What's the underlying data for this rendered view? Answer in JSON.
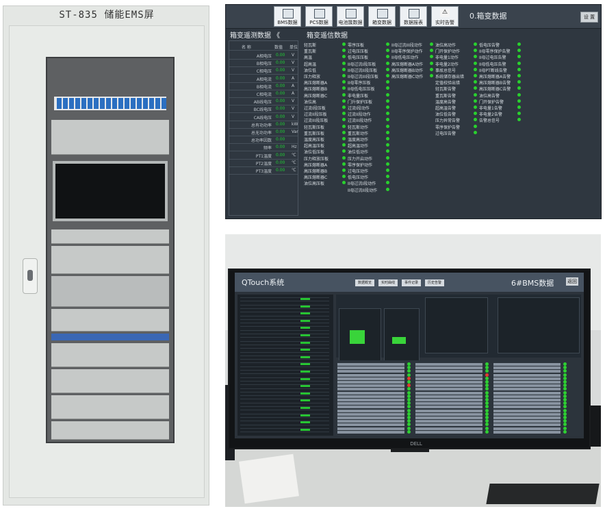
{
  "cabinet": {
    "title": "ST-835 储能EMS屏"
  },
  "screen1": {
    "toolbar": [
      {
        "label": "BMS数据",
        "icon": "battery-icon"
      },
      {
        "label": "PCS数据",
        "icon": "monitor-icon"
      },
      {
        "label": "电池簇数据",
        "icon": "battery-cluster-icon"
      },
      {
        "label": "箱变数据",
        "icon": "transformer-icon"
      },
      {
        "label": "数据报表",
        "icon": "report-icon"
      },
      {
        "label": "实时告警",
        "icon": "warning-icon"
      }
    ],
    "title": "0.箱变数据",
    "settings_label": "设 置",
    "left_title": "箱变遥测数据 《",
    "right_title": "箱变遥信数据",
    "measure_headers": {
      "name": "名 称",
      "value": "数值",
      "unit": "单位"
    },
    "measurements": [
      {
        "name": "A相电压",
        "value": "0.00",
        "unit": "V"
      },
      {
        "name": "B相电压",
        "value": "0.00",
        "unit": "V"
      },
      {
        "name": "C相电压",
        "value": "0.00",
        "unit": "V"
      },
      {
        "name": "A相电流",
        "value": "0.00",
        "unit": "A"
      },
      {
        "name": "B相电流",
        "value": "0.00",
        "unit": "A"
      },
      {
        "name": "C相电流",
        "value": "0.00",
        "unit": "A"
      },
      {
        "name": "AB线电压",
        "value": "0.00",
        "unit": "V"
      },
      {
        "name": "BC线电压",
        "value": "0.00",
        "unit": "V"
      },
      {
        "name": "CA线电压",
        "value": "0.00",
        "unit": "V"
      },
      {
        "name": "总有功功率",
        "value": "0.00",
        "unit": "kW"
      },
      {
        "name": "总无功功率",
        "value": "0.00",
        "unit": "Var"
      },
      {
        "name": "总功率因数",
        "value": "0.00",
        "unit": ""
      },
      {
        "name": "频率",
        "value": "0.00",
        "unit": "Hz"
      },
      {
        "name": "PT1温度",
        "value": "0.00",
        "unit": "℃"
      },
      {
        "name": "PT2温度",
        "value": "0.00",
        "unit": "℃"
      },
      {
        "name": "PT3温度",
        "value": "0.00",
        "unit": "℃"
      }
    ],
    "signal_columns": [
      [
        "轻瓦斯",
        "重瓦斯",
        "高温",
        "超高温",
        "油位低",
        "压力释放",
        "高压熔断器A",
        "高压熔断器B",
        "高压熔断器C",
        "油位高",
        "过流I段压板",
        "过流II段压板",
        "过流III段压板",
        "轻瓦斯压板",
        "重瓦斯压板",
        "温度高压板",
        "超高温压板",
        "油位低压板",
        "压力释放压板",
        "高压熔断器A",
        "高压熔断器B",
        "高压熔断器C",
        "油位高压板"
      ],
      [
        "零序压板",
        "过电压压板",
        "低电压压板",
        "II母过流I段压板",
        "II母过流II段压板",
        "II母过流III段压板",
        "II母零序压板",
        "II母低电压压板",
        "非电量压板",
        "门升保护压板",
        "过流I段动作",
        "过流II段动作",
        "过流III段动作",
        "轻瓦斯动作",
        "重瓦斯动作",
        "温度高动作",
        "超高温动作",
        "油位低动作",
        "压力开启动作",
        "零序保护动作",
        "过电压动作",
        "低电压动作",
        "II母过流I段动作",
        "II母过流II段动作"
      ],
      [
        "II母过流III段动作",
        "II母零序保护动作",
        "II母低电压动作",
        "高压熔断器A动作",
        "高压熔断器B动作",
        "高压熔断器C动作"
      ],
      [
        "油位高动作",
        "门开保护动作",
        "非电量1动作",
        "非电量2动作",
        "事故总信号",
        "系统储存器出错",
        "定值校验出错",
        "轻瓦斯告警",
        "重瓦斯告警",
        "温度高告警",
        "超高温告警",
        "油位低告警",
        "压力异常告警",
        "零序保护告警",
        "过电压告警"
      ],
      [
        "低电压告警",
        "II母零序保护告警",
        "II母过电压告警",
        "II母低电压告警",
        "II母PT断线告警",
        "高压熔断器A告警",
        "高压熔断器B告警",
        "高压熔断器C告警",
        "油位高告警",
        "门开保护告警",
        "非电量1告警",
        "非电量2告警",
        "告警总信号"
      ]
    ]
  },
  "screen2": {
    "title": "QTouch系统",
    "right_title": "6#BMS数据",
    "close_label": "返回",
    "nav": [
      "数据概览",
      "实时曲线",
      "事件记录",
      "历史告警"
    ]
  },
  "monitor_brand": "DELL"
}
